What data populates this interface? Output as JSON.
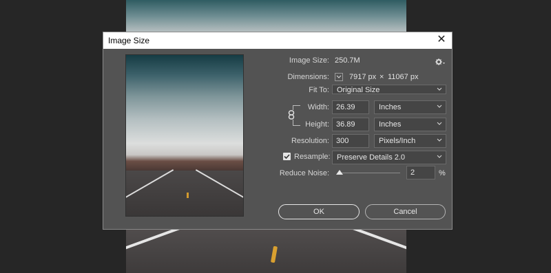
{
  "dialog": {
    "title": "Image Size",
    "close_glyph": "✕"
  },
  "info": {
    "image_size_label": "Image Size:",
    "image_size_value": "250.7M",
    "dimensions_label": "Dimensions:",
    "dimensions_width": "7917 px",
    "dimensions_times": "×",
    "dimensions_height": "11067 px"
  },
  "fit_to": {
    "label": "Fit To:",
    "value": "Original Size"
  },
  "width": {
    "label": "Width:",
    "value": "26.39",
    "unit": "Inches"
  },
  "height": {
    "label": "Height:",
    "value": "36.89",
    "unit": "Inches"
  },
  "resolution": {
    "label": "Resolution:",
    "value": "300",
    "unit": "Pixels/Inch"
  },
  "resample": {
    "label": "Resample:",
    "checked": true,
    "value": "Preserve Details 2.0"
  },
  "reduce_noise": {
    "label": "Reduce Noise:",
    "value": "2",
    "unit": "%",
    "level": 0.02
  },
  "buttons": {
    "ok": "OK",
    "cancel": "Cancel"
  },
  "icons": {
    "gear": "gear-icon",
    "chain": "chain-link-icon",
    "chevron": "chevron-down-icon",
    "close": "close-icon"
  },
  "colors": {
    "dialog_bg": "#535353",
    "field_bg": "#454545",
    "workspace_bg": "#262626"
  }
}
